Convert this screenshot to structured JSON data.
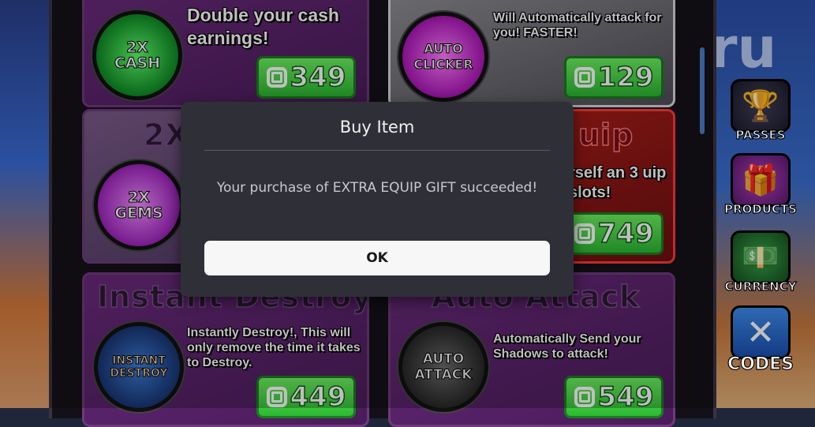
{
  "background": {
    "right_text": "ru"
  },
  "shop": {
    "cards": [
      {
        "title": "",
        "icon_text": "2X CASH",
        "description": "Double your cash earnings!",
        "price": "349"
      },
      {
        "title": "",
        "icon_text": "AUTO CLICKER",
        "description": "Will Automatically attack for you! FASTER!",
        "price": "129"
      },
      {
        "title": "2X",
        "icon_text": "2X GEMS",
        "description": "",
        "price": ""
      },
      {
        "title": "uip",
        "icon_text": "",
        "description": "rself an 3 uip slots!",
        "price": "749"
      },
      {
        "title": "Instant Destroy",
        "icon_text": "INSTANT DESTROY",
        "description": "Instantly Destroy!, This will only remove the time it takes to Destroy.",
        "price": "449"
      },
      {
        "title": "Auto Attack",
        "icon_text": "AUTO ATTACK",
        "description": "Automatically Send your Shadows to attack!",
        "price": "549"
      }
    ]
  },
  "sidebar": {
    "buttons": [
      {
        "label": "PASSES",
        "icon": "trophy-icon"
      },
      {
        "label": "PRODUCTS",
        "icon": "gift-basket-icon"
      },
      {
        "label": "CURRENCY",
        "icon": "cash-stack-icon"
      },
      {
        "label": "CODES",
        "icon": "x-icon"
      }
    ]
  },
  "modal": {
    "title": "Buy Item",
    "message": "Your purchase of EXTRA EQUIP GIFT succeeded!",
    "ok_label": "OK"
  },
  "colors": {
    "price_green": "#3fd43c",
    "modal_bg": "#2f3037",
    "card_purple": "#6a2a7c",
    "card_red": "#b5201c"
  }
}
